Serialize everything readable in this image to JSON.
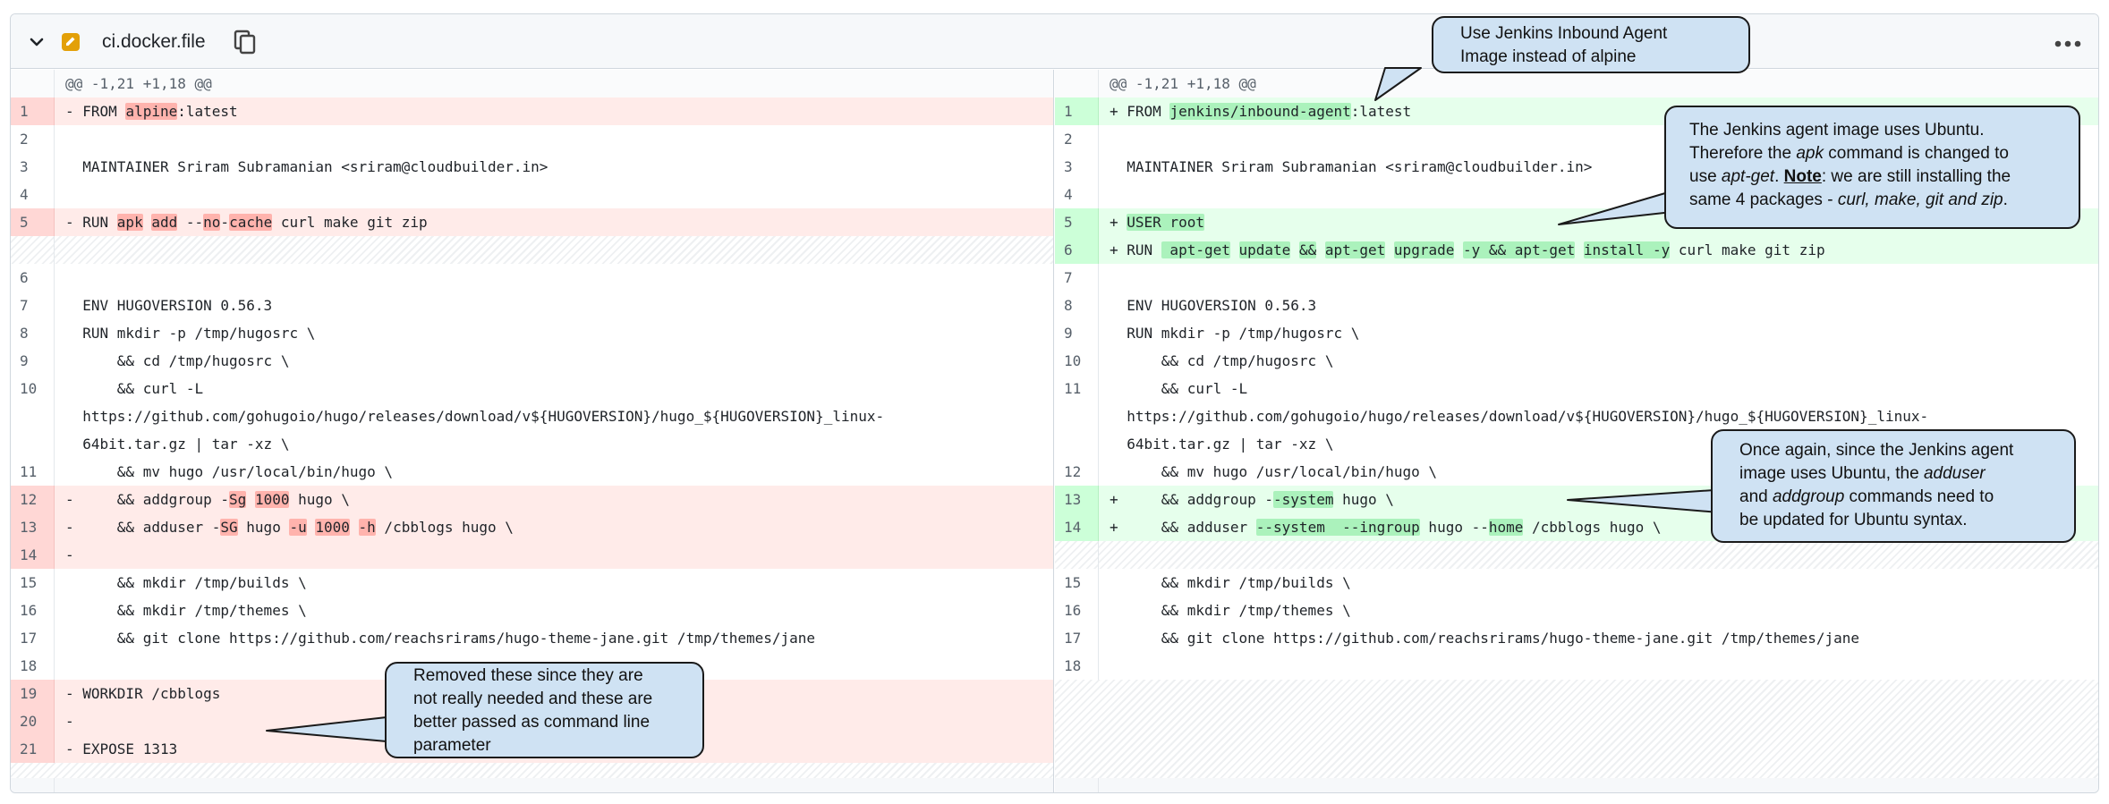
{
  "file": {
    "name": "ci.docker.file"
  },
  "hunk_header": "@@ -1,21 +1,18 @@",
  "more_rows_glyph": "...",
  "colors": {
    "deleted_bg": "#ffebe9",
    "added_bg": "#e6ffec",
    "callout_bg": "#cfe2f3"
  },
  "left": [
    {
      "n": "1",
      "m": "- ",
      "t": "del",
      "segs": [
        [
          "FROM ",
          0
        ],
        [
          "alpine",
          1
        ],
        [
          ":latest",
          0
        ]
      ]
    },
    {
      "n": "2",
      "m": "",
      "t": "ctx",
      "segs": []
    },
    {
      "n": "3",
      "m": "  ",
      "t": "ctx",
      "segs": [
        [
          "MAINTAINER Sriram Subramanian <sriram@cloudbuilder.in>",
          0
        ]
      ]
    },
    {
      "n": "4",
      "m": "",
      "t": "ctx",
      "segs": []
    },
    {
      "n": "5",
      "m": "- ",
      "t": "del",
      "segs": [
        [
          "RUN ",
          0
        ],
        [
          "apk",
          1
        ],
        " ",
        [
          "add",
          1
        ],
        [
          " --",
          0
        ],
        [
          "no",
          1
        ],
        [
          "-",
          0
        ],
        [
          "cache",
          1
        ],
        [
          " curl make git zip",
          0
        ]
      ]
    },
    {
      "n": "",
      "m": "",
      "t": "gap",
      "segs": []
    },
    {
      "n": "6",
      "m": "",
      "t": "ctx",
      "segs": []
    },
    {
      "n": "7",
      "m": "  ",
      "t": "ctx",
      "segs": [
        [
          "ENV HUGOVERSION 0.56.3",
          0
        ]
      ]
    },
    {
      "n": "8",
      "m": "  ",
      "t": "ctx",
      "segs": [
        [
          "RUN mkdir -p /tmp/hugosrc \\",
          0
        ]
      ]
    },
    {
      "n": "9",
      "m": "  ",
      "t": "ctx",
      "segs": [
        [
          "    && cd /tmp/hugosrc \\",
          0
        ]
      ]
    },
    {
      "n": "10",
      "m": "  ",
      "t": "ctx",
      "segs": [
        [
          "    && curl -L",
          0
        ]
      ]
    },
    {
      "n": "",
      "m": "  ",
      "t": "ctx",
      "segs": [
        [
          "https://github.com/gohugoio/hugo/releases/download/v${HUGOVERSION}/hugo_${HUGOVERSION}_linux-",
          0
        ]
      ]
    },
    {
      "n": "",
      "m": "  ",
      "t": "ctx",
      "segs": [
        [
          "64bit.tar.gz | tar -xz \\",
          0
        ]
      ]
    },
    {
      "n": "11",
      "m": "  ",
      "t": "ctx",
      "segs": [
        [
          "    && mv hugo /usr/local/bin/hugo \\",
          0
        ]
      ]
    },
    {
      "n": "12",
      "m": "- ",
      "t": "del",
      "segs": [
        [
          "    && addgroup -",
          0
        ],
        [
          "Sg",
          1
        ],
        [
          " ",
          0
        ],
        [
          "1000",
          1
        ],
        [
          " hugo \\",
          0
        ]
      ]
    },
    {
      "n": "13",
      "m": "- ",
      "t": "del",
      "segs": [
        [
          "    && adduser -",
          0
        ],
        [
          "SG",
          1
        ],
        [
          " hugo ",
          0
        ],
        [
          "-u",
          1
        ],
        [
          " ",
          0
        ],
        [
          "1000",
          1
        ],
        [
          " ",
          0
        ],
        [
          "-h",
          1
        ],
        [
          " /cbblogs hugo \\",
          0
        ]
      ]
    },
    {
      "n": "14",
      "m": "- ",
      "t": "del",
      "segs": []
    },
    {
      "n": "15",
      "m": "  ",
      "t": "ctx",
      "segs": [
        [
          "    && mkdir /tmp/builds \\",
          0
        ]
      ]
    },
    {
      "n": "16",
      "m": "  ",
      "t": "ctx",
      "segs": [
        [
          "    && mkdir /tmp/themes \\",
          0
        ]
      ]
    },
    {
      "n": "17",
      "m": "  ",
      "t": "ctx",
      "segs": [
        [
          "    && git clone https://github.com/reachsrirams/hugo-theme-jane.git /tmp/themes/jane",
          0
        ]
      ]
    },
    {
      "n": "18",
      "m": "",
      "t": "ctx",
      "segs": []
    },
    {
      "n": "19",
      "m": "- ",
      "t": "del",
      "segs": [
        [
          "WORKDIR /cbblogs",
          0
        ]
      ]
    },
    {
      "n": "20",
      "m": "- ",
      "t": "del",
      "segs": []
    },
    {
      "n": "21",
      "m": "- ",
      "t": "del",
      "segs": [
        [
          "EXPOSE 1313",
          0
        ]
      ]
    }
  ],
  "right": [
    {
      "n": "1",
      "m": "+ ",
      "t": "add",
      "segs": [
        [
          "FROM ",
          0
        ],
        [
          "jenkins/inbound-agent",
          1
        ],
        [
          ":latest",
          0
        ]
      ]
    },
    {
      "n": "2",
      "m": "",
      "t": "ctx",
      "segs": []
    },
    {
      "n": "3",
      "m": "  ",
      "t": "ctx",
      "segs": [
        [
          "MAINTAINER Sriram Subramanian <sriram@cloudbuilder.in>",
          0
        ]
      ]
    },
    {
      "n": "4",
      "m": "",
      "t": "ctx",
      "segs": []
    },
    {
      "n": "5",
      "m": "+ ",
      "t": "add",
      "segs": [
        [
          "USER root",
          1
        ]
      ]
    },
    {
      "n": "6",
      "m": "+ ",
      "t": "add",
      "segs": [
        [
          "RUN ",
          0
        ],
        [
          " apt-get",
          1
        ],
        [
          " ",
          0
        ],
        [
          "update",
          1
        ],
        [
          " ",
          0
        ],
        [
          "&&",
          1
        ],
        [
          " ",
          0
        ],
        [
          "apt-get",
          1
        ],
        [
          " ",
          0
        ],
        [
          "upgrade",
          1
        ],
        [
          " ",
          0
        ],
        [
          "-y && apt-get",
          1
        ],
        [
          " ",
          0
        ],
        [
          "install -y",
          1
        ],
        [
          " curl make git zip",
          0
        ]
      ]
    },
    {
      "n": "7",
      "m": "",
      "t": "ctx",
      "segs": []
    },
    {
      "n": "8",
      "m": "  ",
      "t": "ctx",
      "segs": [
        [
          "ENV HUGOVERSION 0.56.3",
          0
        ]
      ]
    },
    {
      "n": "9",
      "m": "  ",
      "t": "ctx",
      "segs": [
        [
          "RUN mkdir -p /tmp/hugosrc \\",
          0
        ]
      ]
    },
    {
      "n": "10",
      "m": "  ",
      "t": "ctx",
      "segs": [
        [
          "    && cd /tmp/hugosrc \\",
          0
        ]
      ]
    },
    {
      "n": "11",
      "m": "  ",
      "t": "ctx",
      "segs": [
        [
          "    && curl -L",
          0
        ]
      ]
    },
    {
      "n": "",
      "m": "  ",
      "t": "ctx",
      "segs": [
        [
          "https://github.com/gohugoio/hugo/releases/download/v${HUGOVERSION}/hugo_${HUGOVERSION}_linux-",
          0
        ]
      ]
    },
    {
      "n": "",
      "m": "  ",
      "t": "ctx",
      "segs": [
        [
          "64bit.tar.gz | tar -xz \\",
          0
        ]
      ]
    },
    {
      "n": "12",
      "m": "  ",
      "t": "ctx",
      "segs": [
        [
          "    && mv hugo /usr/local/bin/hugo \\",
          0
        ]
      ]
    },
    {
      "n": "13",
      "m": "+ ",
      "t": "add",
      "segs": [
        [
          "    && addgroup -",
          0
        ],
        [
          "-system",
          1
        ],
        [
          " hugo \\",
          0
        ]
      ]
    },
    {
      "n": "14",
      "m": "+ ",
      "t": "add",
      "segs": [
        [
          "    && adduser ",
          0
        ],
        [
          "--system  --ingroup",
          1
        ],
        [
          " hugo --",
          0
        ],
        [
          "home",
          1
        ],
        [
          " /cbblogs hugo \\",
          0
        ]
      ]
    },
    {
      "n": "",
      "m": "",
      "t": "gap",
      "segs": []
    },
    {
      "n": "15",
      "m": "  ",
      "t": "ctx",
      "segs": [
        [
          "    && mkdir /tmp/builds \\",
          0
        ]
      ]
    },
    {
      "n": "16",
      "m": "  ",
      "t": "ctx",
      "segs": [
        [
          "    && mkdir /tmp/themes \\",
          0
        ]
      ]
    },
    {
      "n": "17",
      "m": "  ",
      "t": "ctx",
      "segs": [
        [
          "    && git clone https://github.com/reachsrirams/hugo-theme-jane.git /tmp/themes/jane",
          0
        ]
      ]
    },
    {
      "n": "18",
      "m": "",
      "t": "ctx",
      "segs": []
    }
  ],
  "callouts": {
    "jenkins_image": {
      "line1": "Use Jenkins Inbound Agent",
      "line2": "Image instead of alpine"
    },
    "ubuntu_apt": {
      "l1": "The Jenkins agent image uses Ubuntu.",
      "l2a": "Therefore the ",
      "l2b": "apk",
      "l2c": " command is changed to",
      "l3a": "use ",
      "l3b": "apt-get",
      "l3c": ". ",
      "l3d": "Note",
      "l3e": ": we are still installing the",
      "l4a": "same 4 packages - ",
      "l4b": "curl, make, git and zip",
      "l4c": "."
    },
    "ubuntu_adduser": {
      "l1": "Once again, since the Jenkins agent",
      "l2a": "image uses Ubuntu, the ",
      "l2b": "adduser",
      "l3a": "and ",
      "l3b": "addgroup",
      "l3c": " commands need to",
      "l4": "be updated for Ubuntu syntax."
    },
    "removed": {
      "l1": "Removed these since they are",
      "l2": "not really needed and these are",
      "l3": "better passed as command line",
      "l4": "parameter"
    }
  }
}
